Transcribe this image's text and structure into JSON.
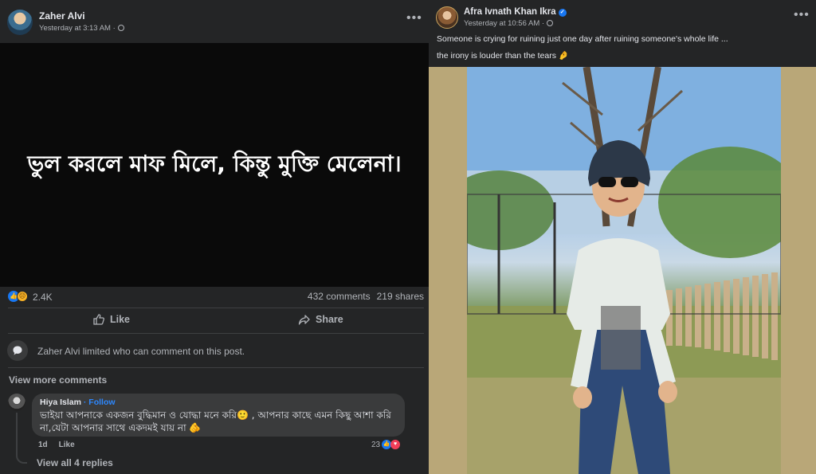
{
  "left_post": {
    "author": "Zaher Alvi",
    "timestamp": "Yesterday at 3:13 AM ·",
    "more_icon": "more-dots-icon",
    "quote_text": "ভুল করলে মাফ মিলে, কিন্তু মুক্তি মেলেনা।",
    "reactions_count": "2.4K",
    "comments_count": "432 comments",
    "shares_count": "219 shares",
    "like_label": "Like",
    "share_label": "Share",
    "limited_notice": "Zaher Alvi limited who can comment on this post.",
    "view_more_comments": "View more comments",
    "comment": {
      "author": "Hiya Islam",
      "follow": "· Follow",
      "text": "ভাইয়া আপনাকে একজন বুদ্ধিমান ও যোদ্ধা মনে করি🙂 , আপনার কাছে এমন কিছু আশা করি না,যেটা আপনার সাথে একদমই যায় না 🫵",
      "age": "1d",
      "like_label": "Like",
      "reaction_count": "23"
    },
    "view_replies": "View all 4 replies"
  },
  "right_post": {
    "author": "Afra Ivnath Khan Ikra",
    "timestamp": "Yesterday at 10:56 AM ·",
    "caption_line1": "Someone is crying for ruining just one day after ruining someone's whole life ...",
    "caption_line2": "the irony is louder than the tears 🤌",
    "photo": "woman-in-helmet-photo"
  },
  "colors": {
    "background": "#242526",
    "text_primary": "#e4e6eb",
    "text_secondary": "#b0b3b8",
    "link_blue": "#2d88ff",
    "like_blue": "#1877f2",
    "photo_border": "#b9a778"
  }
}
